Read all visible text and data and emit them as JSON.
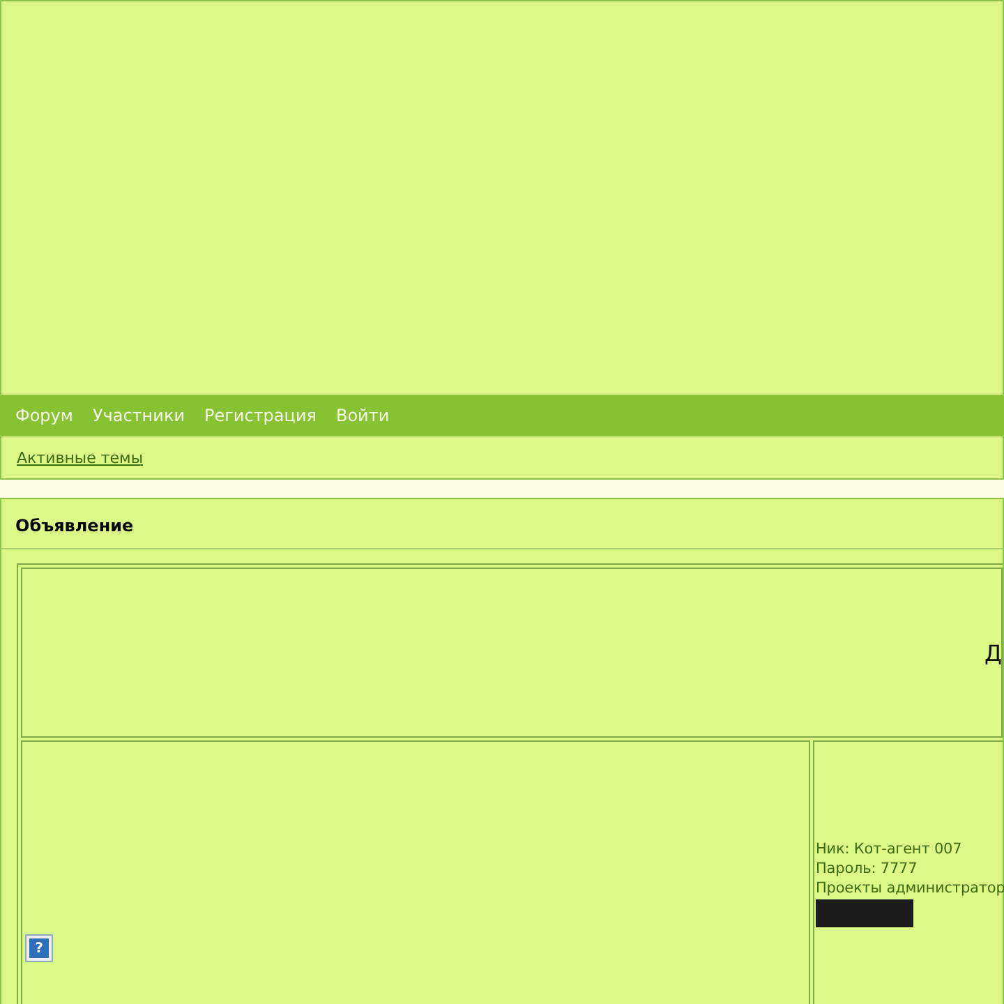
{
  "nav": {
    "items": [
      {
        "label": "Форум"
      },
      {
        "label": "Участники"
      },
      {
        "label": "Регистрация"
      },
      {
        "label": "Войти"
      }
    ]
  },
  "subnav": {
    "link": "Активные темы"
  },
  "announcement": {
    "title": "Объявление",
    "top_cell_text": "Д",
    "help_glyph": "?",
    "info_lines": [
      "Ник: Кот-агент 007",
      "Пароль: 7777",
      "Проекты администратор"
    ]
  }
}
